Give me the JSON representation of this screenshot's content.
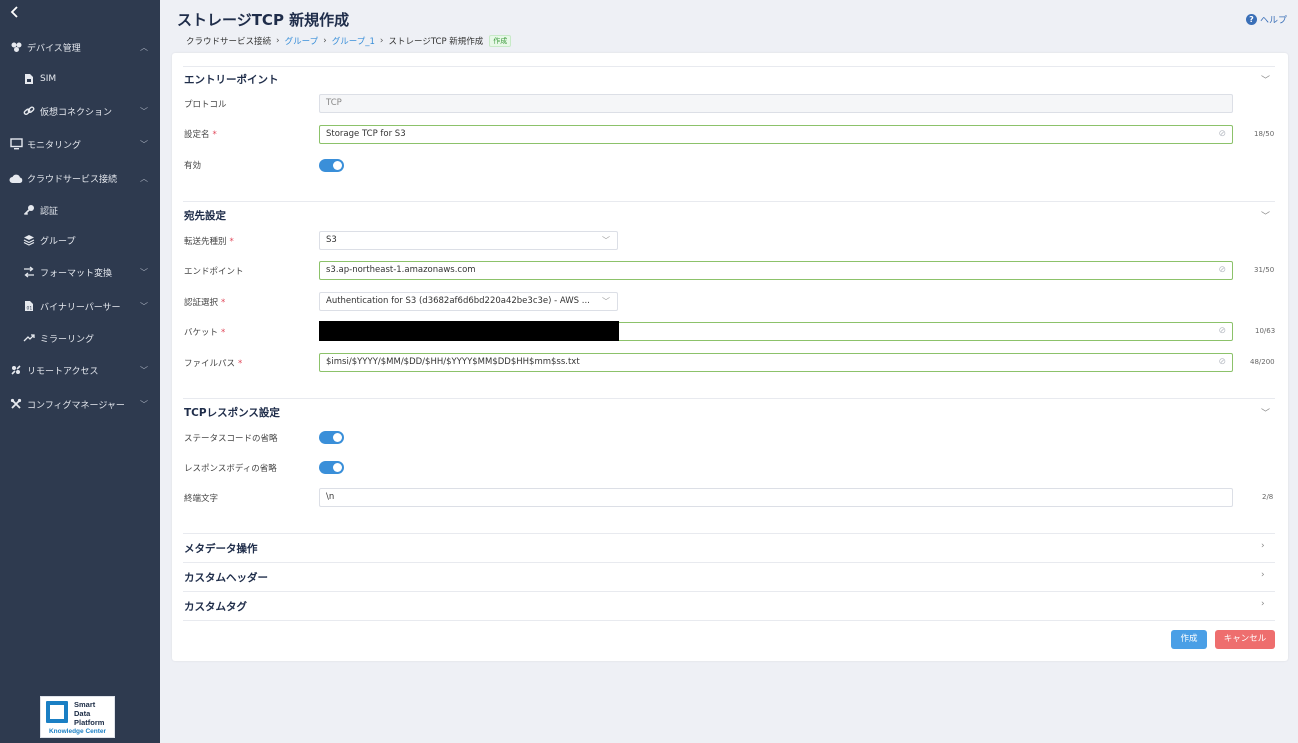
{
  "sidebar": {
    "items": [
      {
        "label": "デバイス管理",
        "icon": "devices-icon",
        "chevron": "up"
      },
      {
        "label": "SIM",
        "icon": "sim-icon",
        "chevron": ""
      },
      {
        "label": "仮想コネクション",
        "icon": "link-icon",
        "chevron": "down"
      },
      {
        "label": "モニタリング",
        "icon": "monitor-icon",
        "chevron": "down"
      },
      {
        "label": "クラウドサービス接続",
        "icon": "cloud-icon",
        "chevron": "up"
      },
      {
        "label": "認証",
        "icon": "key-icon",
        "chevron": ""
      },
      {
        "label": "グループ",
        "icon": "layers-icon",
        "chevron": ""
      },
      {
        "label": "フォーマット変換",
        "icon": "format-convert-icon",
        "chevron": "down"
      },
      {
        "label": "バイナリーパーサー",
        "icon": "binary-file-icon",
        "chevron": "down"
      },
      {
        "label": "ミラーリング",
        "icon": "mirroring-icon",
        "chevron": ""
      },
      {
        "label": "リモートアクセス",
        "icon": "remote-access-icon",
        "chevron": "down"
      },
      {
        "label": "コンフィグマネージャー",
        "icon": "tools-icon",
        "chevron": "down"
      }
    ],
    "logo": {
      "line1": "Smart",
      "line2": "Data",
      "line3": "Platform",
      "sub": "Knowledge Center"
    }
  },
  "header": {
    "title": "ストレージTCP 新規作成",
    "help": "ヘルプ",
    "breadcrumb": [
      "クラウドサービス接続",
      "グループ",
      "グループ_1",
      "ストレージTCP 新規作成"
    ],
    "badge": "作成"
  },
  "sections": {
    "entry": {
      "title": "エントリーポイント",
      "protocol_label": "プロトコル",
      "protocol_value": "TCP",
      "name_label": "設定名",
      "name_value": "Storage TCP for S3",
      "name_counter": "18/50",
      "enabled_label": "有効"
    },
    "dest": {
      "title": "宛先設定",
      "type_label": "転送先種別",
      "type_value": "S3",
      "endpoint_label": "エンドポイント",
      "endpoint_value": "s3.ap-northeast-1.amazonaws.com",
      "endpoint_counter": "31/50",
      "auth_label": "認証選択",
      "auth_value": "Authentication for S3 (d3682af6d6bd220a42be3c3e) - AWS ...",
      "bucket_label": "バケット",
      "bucket_counter": "10/63",
      "path_label": "ファイルパス",
      "path_value": "$imsi/$YYYY/$MM/$DD/$HH/$YYYY$MM$DD$HH$mm$ss.txt",
      "path_counter": "48/200"
    },
    "tcp": {
      "title": "TCPレスポンス設定",
      "omit_status_label": "ステータスコードの省略",
      "omit_body_label": "レスポンスボディの省略",
      "terminator_label": "終端文字",
      "terminator_value": "\\n",
      "terminator_counter": "2/8"
    },
    "meta": {
      "title": "メタデータ操作"
    },
    "headers": {
      "title": "カスタムヘッダー"
    },
    "tags": {
      "title": "カスタムタグ"
    }
  },
  "buttons": {
    "create": "作成",
    "cancel": "キャンセル"
  },
  "required_mark": "*",
  "colors": {
    "sidebar_bg": "#2e3a4f",
    "accent": "#3a8fd9",
    "success_border": "#8cc26a",
    "cancel": "#ee6e6e"
  }
}
